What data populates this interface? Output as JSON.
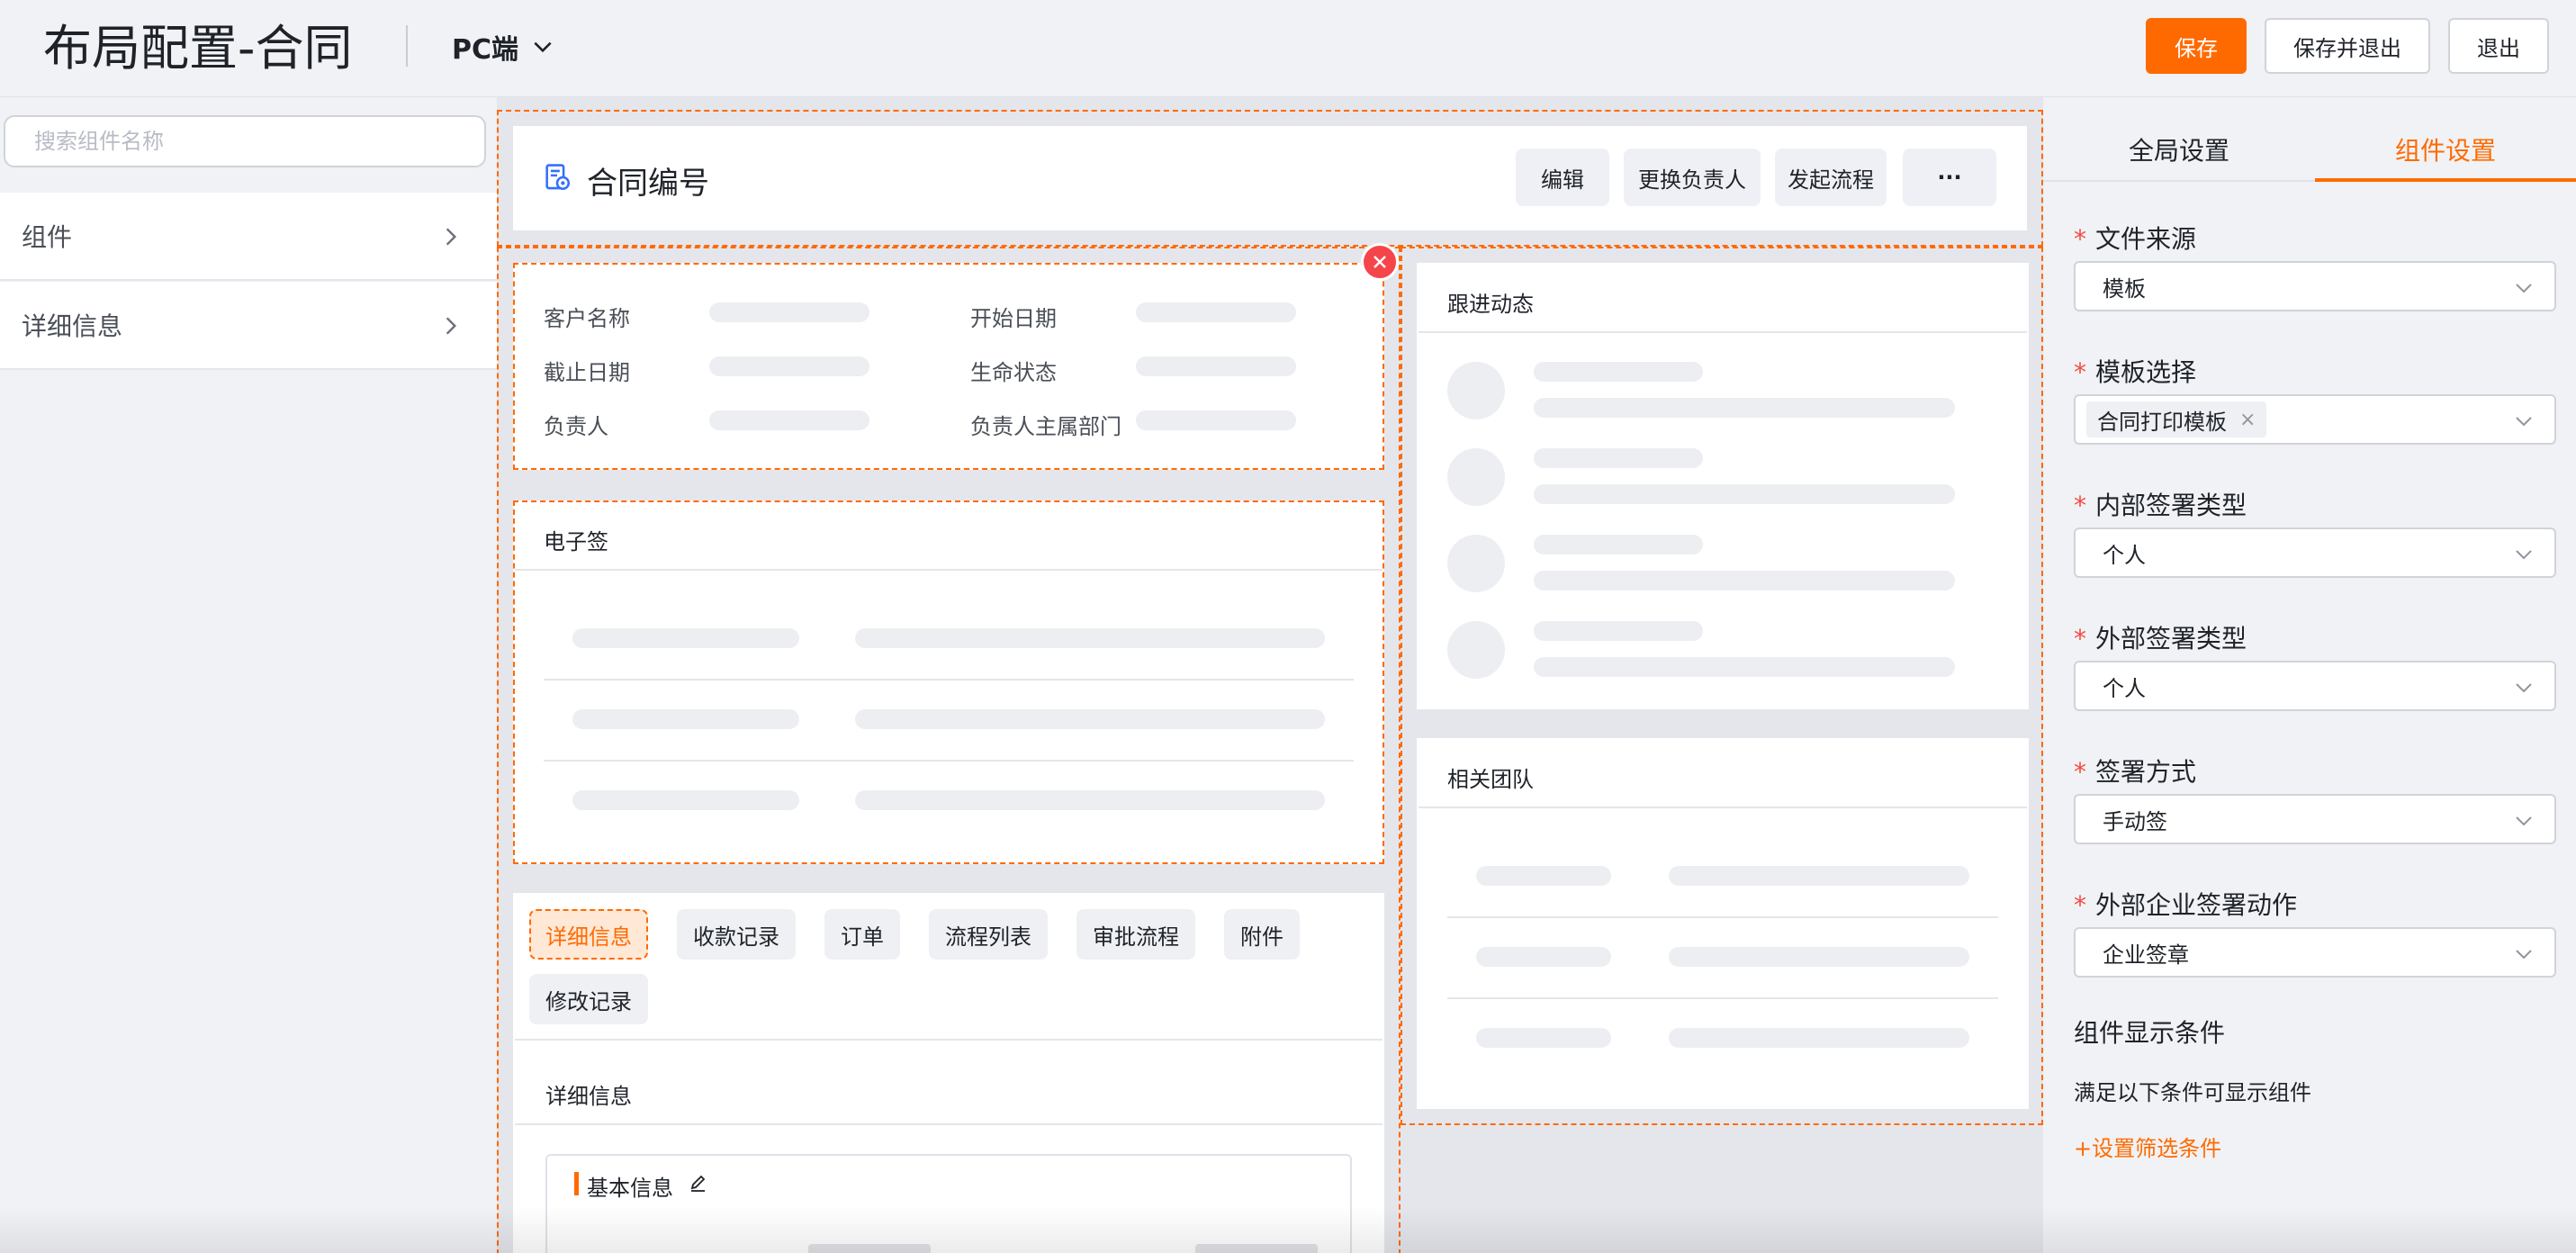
{
  "header": {
    "title": "布局配置-合同",
    "device": "PC端",
    "save": "保存",
    "save_exit": "保存并退出",
    "exit": "退出"
  },
  "left": {
    "search_placeholder": "搜索组件名称",
    "items": [
      {
        "label": "组件"
      },
      {
        "label": "详细信息"
      }
    ]
  },
  "canvas": {
    "header_card": {
      "title": "合同编号",
      "actions": [
        "编辑",
        "更换负责人",
        "发起流程",
        "···"
      ]
    },
    "fields": [
      {
        "label": "客户名称"
      },
      {
        "label": "开始日期"
      },
      {
        "label": "截止日期"
      },
      {
        "label": "生命状态"
      },
      {
        "label": "负责人"
      },
      {
        "label": "负责人主属部门"
      }
    ],
    "esign_title": "电子签",
    "tabs": [
      "详细信息",
      "收款记录",
      "订单",
      "流程列表",
      "审批流程",
      "附件",
      "修改记录"
    ],
    "detail_title": "详细信息",
    "basic_info": "基本信息",
    "follow_title": "跟进动态",
    "team_title": "相关团队"
  },
  "right": {
    "tabs": [
      "全局设置",
      "组件设置"
    ],
    "active_tab": 1,
    "props": [
      {
        "label": "文件来源",
        "value": "模板"
      },
      {
        "label": "模板选择",
        "value": "合同打印模板"
      },
      {
        "label": "内部签署类型",
        "value": "个人"
      },
      {
        "label": "外部签署类型",
        "value": "个人"
      },
      {
        "label": "签署方式",
        "value": "手动签"
      },
      {
        "label": "外部企业签署动作",
        "value": "企业签章"
      }
    ],
    "cond_title": "组件显示条件",
    "cond_desc": "满足以下条件可显示组件",
    "cond_link": "+设置筛选条件"
  },
  "colors": {
    "accent": "#ff6a00",
    "required": "#f54a45"
  }
}
